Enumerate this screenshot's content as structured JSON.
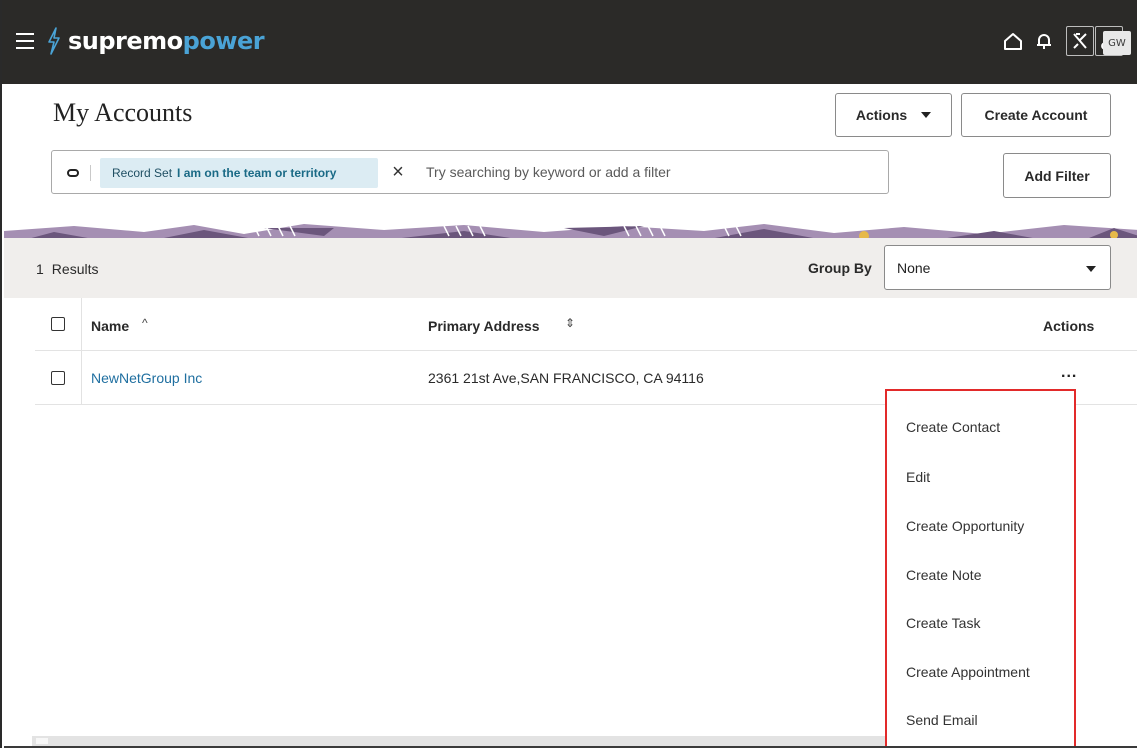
{
  "app": {
    "brand_part1": "supremo",
    "brand_part2": "power",
    "avatar_initials": "GW"
  },
  "header": {
    "title": "My Accounts",
    "actions_button": "Actions",
    "create_button": "Create Account"
  },
  "search": {
    "chip_label": "Record Set",
    "chip_value": "I am on the team or territory",
    "placeholder": "Try searching by keyword or add a filter",
    "add_filter_button": "Add Filter"
  },
  "results": {
    "count": "1",
    "label": "Results",
    "group_by_label": "Group By",
    "group_by_value": "None"
  },
  "table": {
    "columns": {
      "name": "Name",
      "address": "Primary Address",
      "actions": "Actions"
    },
    "rows": [
      {
        "name": "NewNetGroup Inc",
        "address": "2361 21st Ave,SAN FRANCISCO, CA 94116",
        "actions": "..."
      }
    ]
  },
  "row_menu": {
    "items": [
      "Create Contact",
      "Edit",
      "Create Opportunity",
      "Create Note",
      "Create Task",
      "Create Appointment",
      "Send Email"
    ]
  },
  "colors": {
    "topbar": "#2b2a28",
    "brand_accent": "#4aa3d6",
    "link": "#1f6fa0",
    "chip_bg": "#dcecf3",
    "menu_highlight": "#e22a2a",
    "results_bar": "#f0eeec"
  },
  "icons": [
    "hamburger-icon",
    "bolt-icon",
    "home-icon",
    "bell-icon",
    "tool-icon",
    "scissors-icon",
    "toggle-icon",
    "close-icon",
    "sort-up-icon",
    "sort-icon",
    "chevron-down-icon",
    "more-icon"
  ]
}
